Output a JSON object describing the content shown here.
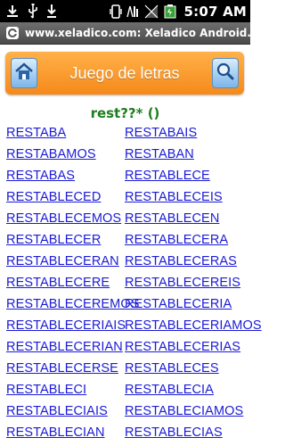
{
  "status_bar": {
    "time": "5:07 AM",
    "icons": [
      "download-icon",
      "usb-icon",
      "sync-icon",
      "vibrate-icon",
      "no-signal-icon",
      "battery-icon"
    ]
  },
  "title_bar": {
    "title": "www.xeladico.com: Xeladico Android..."
  },
  "header": {
    "title": "Juego de letras",
    "home_icon": "home-icon",
    "search_icon": "search-icon"
  },
  "query": "rest??* ()",
  "words": [
    "RESTABA",
    "RESTABAIS",
    "RESTABAMOS",
    "RESTABAN",
    "RESTABAS",
    "RESTABLECE",
    "RESTABLECED",
    "RESTABLECEIS",
    "RESTABLECEMOS",
    "RESTABLECEN",
    "RESTABLECER",
    "RESTABLECERA",
    "RESTABLECERAN",
    "RESTABLECERAS",
    "RESTABLECERE",
    "RESTABLECEREIS",
    "RESTABLECEREMOS",
    "RESTABLECERIA",
    "RESTABLECERIAIS",
    "RESTABLECERIAMOS",
    "RESTABLECERIAN",
    "RESTABLECERIAS",
    "RESTABLECERSE",
    "RESTABLECES",
    "RESTABLECI",
    "RESTABLECIA",
    "RESTABLECIAIS",
    "RESTABLECIAMOS",
    "RESTABLECIAN",
    "RESTABLECIAS"
  ]
}
